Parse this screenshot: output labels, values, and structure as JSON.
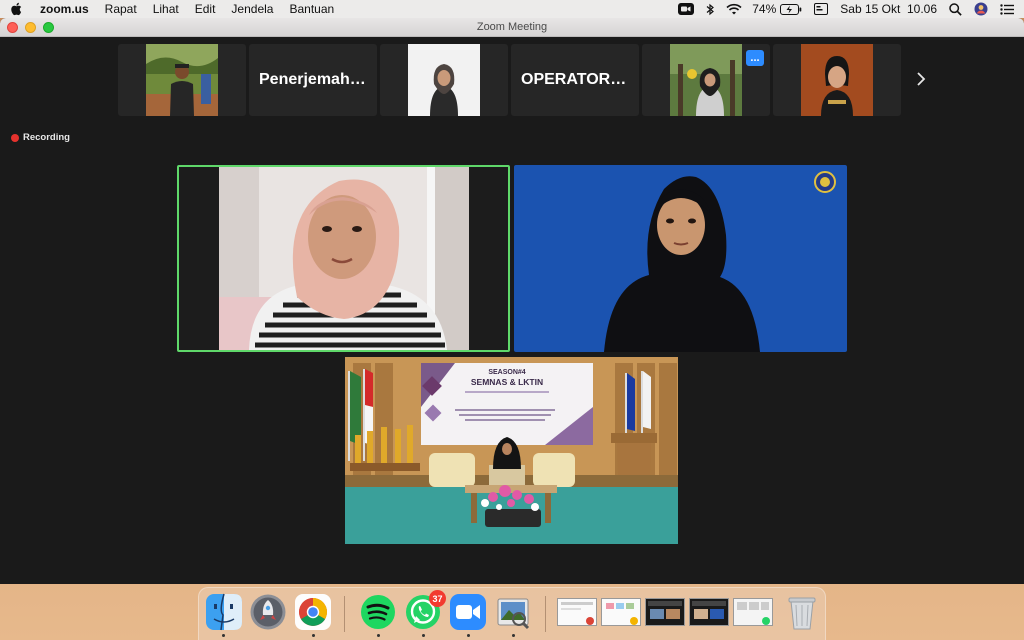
{
  "menubar": {
    "app_name": "zoom.us",
    "menus": [
      "Rapat",
      "Lihat",
      "Edit",
      "Jendela",
      "Bantuan"
    ],
    "battery": "74%",
    "datetime": "Sab 15 Okt  10.06"
  },
  "window": {
    "title": "Zoom Meeting"
  },
  "participants_strip": {
    "tiles": [
      {
        "type": "photo",
        "icon": "person-photo-outdoor"
      },
      {
        "type": "name",
        "label": "Penerjemah I..."
      },
      {
        "type": "photo",
        "icon": "person-photo-hijab"
      },
      {
        "type": "name",
        "label": "OPERATOR S..."
      },
      {
        "type": "photo",
        "icon": "person-photo-hijab-outdoor",
        "more": "..."
      },
      {
        "type": "photo",
        "icon": "person-photo-woman"
      }
    ],
    "next_icon": "chevron-right-icon"
  },
  "recording": {
    "label": "Recording",
    "color": "#e5322d"
  },
  "videos": {
    "active_speaker_border": "#5fd86a",
    "stage": {
      "banner_title": "SEASON#4",
      "banner_subtitle": "SEMNAS & LKTIN"
    }
  },
  "dock": {
    "whatsapp_badge": "37",
    "apps": [
      "Finder",
      "Launchpad",
      "Chrome",
      "Spotify",
      "WhatsApp",
      "Zoom",
      "Preview"
    ]
  }
}
